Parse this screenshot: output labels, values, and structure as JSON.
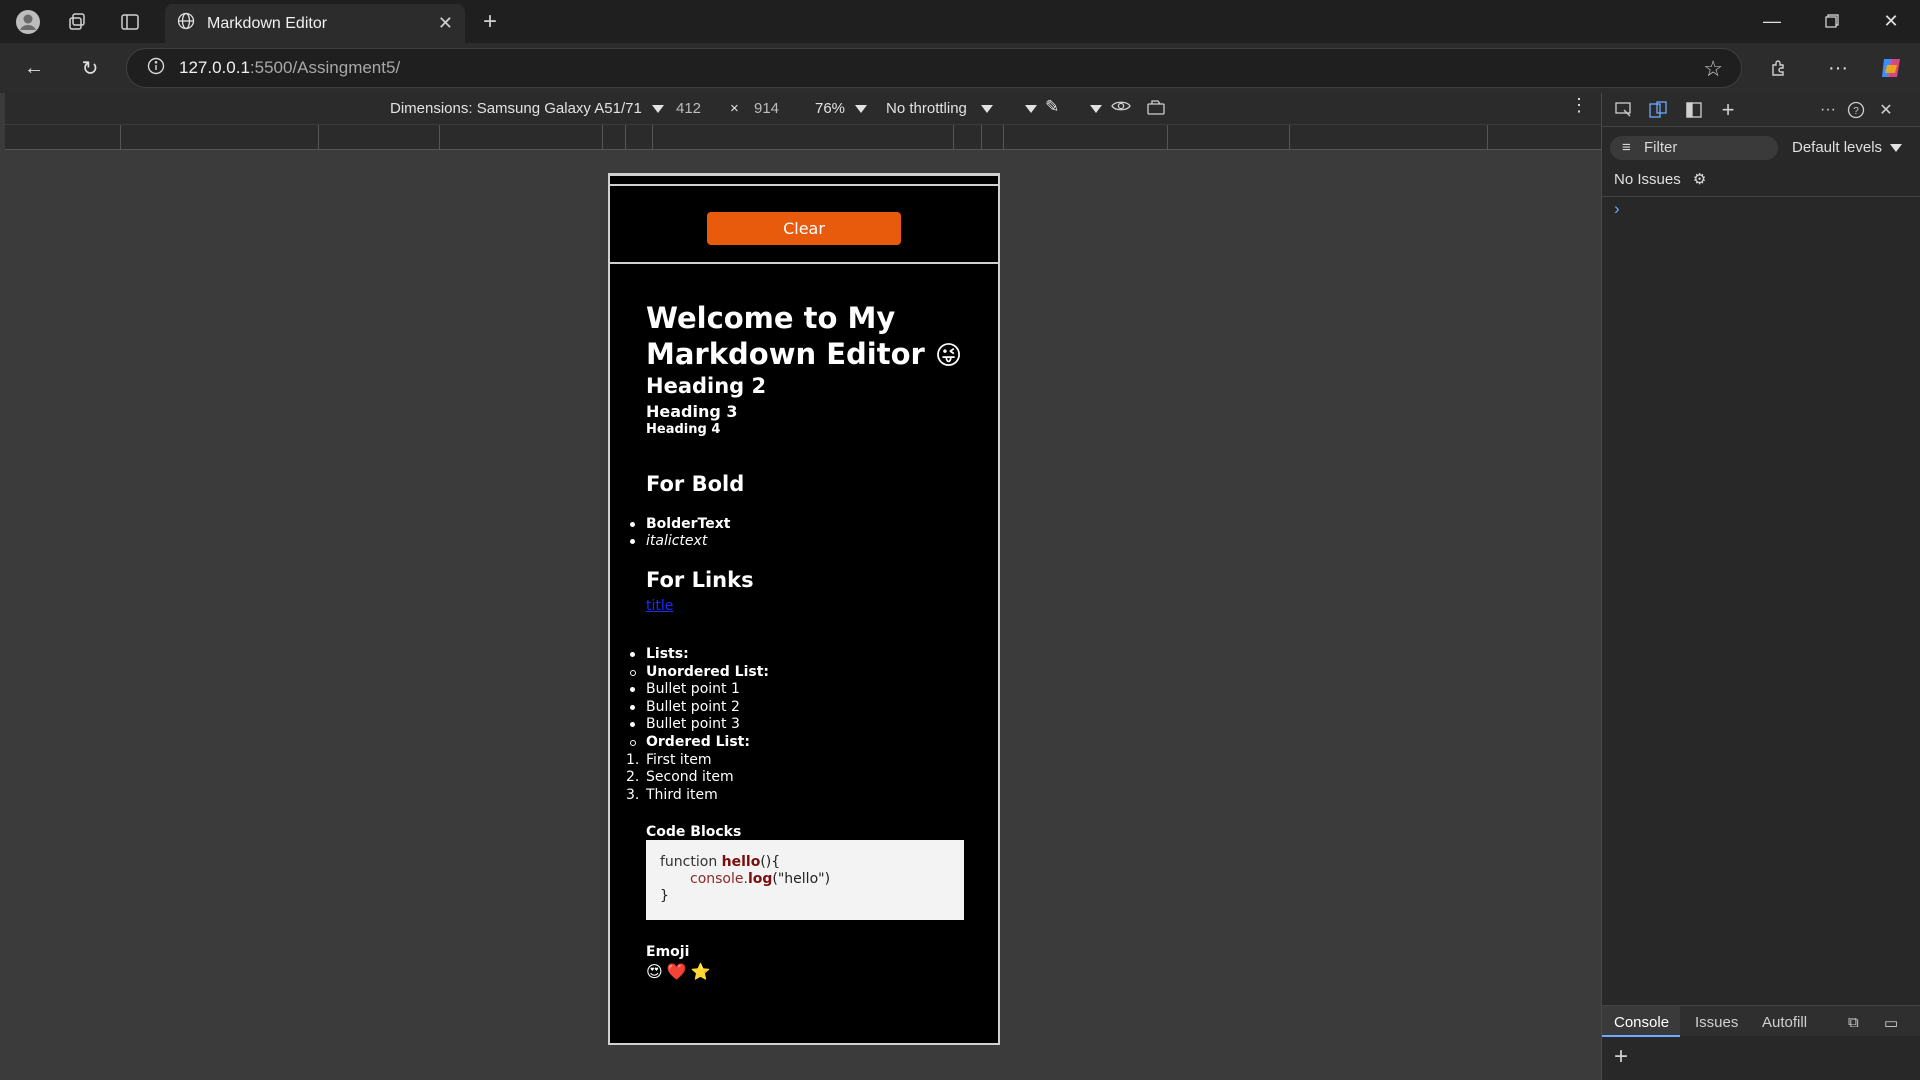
{
  "browser": {
    "tab_title": "Markdown Editor",
    "url_host": "127.0.0.1",
    "url_path": ":5500/Assingment5/"
  },
  "device_toolbar": {
    "dimensions_label": "Dimensions: Samsung Galaxy A51/71",
    "width": "412",
    "times": "×",
    "height": "914",
    "zoom": "76%",
    "throttling": "No throttling"
  },
  "app": {
    "clear_label": "Clear",
    "preview": {
      "h1": "Welcome to My Markdown Editor",
      "h1_emoji": "😜",
      "h2": "Heading 2",
      "h3": "Heading 3",
      "h4": "Heading 4",
      "bold_heading": "For Bold",
      "bold_item": "BolderText",
      "italic_item": "italictext",
      "links_heading": "For Links",
      "link_text": "title",
      "lists_label": "Lists:",
      "unordered_label": "Unordered List:",
      "bullets": [
        "Bullet point 1",
        "Bullet point 2",
        "Bullet point 3"
      ],
      "ordered_label": "Ordered List:",
      "ordered": [
        "First item",
        "Second item",
        "Third item"
      ],
      "ordered_nums": [
        "1.",
        "2.",
        "3."
      ],
      "code_heading": "Code Blocks",
      "code_kw": "function",
      "code_fn": "hello",
      "code_sig": "(){",
      "code_obj": "console.",
      "code_call": "log",
      "code_arg": "(\"hello\")",
      "code_close": "}",
      "emoji_heading": "Emoji",
      "emojis": [
        "😍",
        "❤️",
        "⭐"
      ]
    }
  },
  "devtools": {
    "filter_placeholder": "Filter",
    "levels": "Default levels",
    "no_issues": "No Issues",
    "prompt": "›",
    "drawer_tabs": [
      "Console",
      "Issues",
      "Autofill"
    ]
  }
}
